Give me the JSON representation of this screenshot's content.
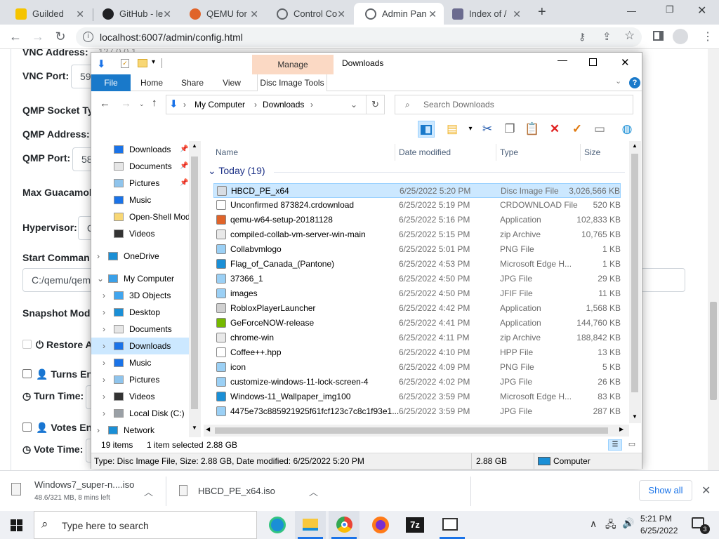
{
  "browser": {
    "tabs": [
      {
        "title": "Guilded",
        "active": false
      },
      {
        "title": "GitHub - le",
        "active": false
      },
      {
        "title": "QEMU for",
        "active": false
      },
      {
        "title": "Control Co",
        "active": false
      },
      {
        "title": "Admin Pan",
        "active": true
      },
      {
        "title": "Index of /",
        "active": false
      }
    ],
    "new_tab": "+",
    "url": "localhost:6007/admin/config.html"
  },
  "page": {
    "fields": {
      "vnc_address": "VNC Address:",
      "vnc_address_value": "127.0.0.1",
      "vnc_port": "VNC Port:",
      "vnc_port_value": "59",
      "qmp_socket": "QMP Socket Ty",
      "qmp_address": "QMP Address:",
      "qmp_port": "QMP Port:",
      "qmp_port_value": "58",
      "max_guac": "Max Guacamol",
      "hypervisor": "Hypervisor:",
      "hypervisor_value": "Q",
      "start_command": "Start Comman",
      "start_command_value": "C:/qemu/qem",
      "snapshot_mode": "Snapshot Mod",
      "restore": "Restore A",
      "turns_enabled": "Turns Ena",
      "turn_time": "Turn Time:",
      "votes_enabled": "Votes Ena",
      "vote_time": "Vote Time:"
    }
  },
  "downloads_bar": {
    "items": [
      {
        "name": "Windows7_super-n....iso",
        "status": "48.6/321 MB, 8 mins left"
      },
      {
        "name": "HBCD_PE_x64.iso",
        "status": ""
      }
    ],
    "show_all": "Show all"
  },
  "taskbar": {
    "search_placeholder": "Type here to search",
    "time": "5:21 PM",
    "date": "6/25/2022",
    "notification_count": "3"
  },
  "explorer": {
    "title": "Downloads",
    "manage_label": "Manage",
    "ribbon_tabs": [
      "File",
      "Home",
      "Share",
      "View",
      "Disc Image Tools"
    ],
    "breadcrumb": [
      "My Computer",
      "Downloads"
    ],
    "search_placeholder": "Search Downloads",
    "nav_items": [
      {
        "label": "Downloads",
        "pinned": true
      },
      {
        "label": "Documents",
        "pinned": true
      },
      {
        "label": "Pictures",
        "pinned": true
      },
      {
        "label": "Music",
        "pinned": false
      },
      {
        "label": "Open-Shell Mod",
        "pinned": false
      },
      {
        "label": "Videos",
        "pinned": false
      },
      {
        "label": "OneDrive",
        "pinned": false
      },
      {
        "label": "My Computer",
        "pinned": false
      },
      {
        "label": "3D Objects",
        "pinned": false
      },
      {
        "label": "Desktop",
        "pinned": false
      },
      {
        "label": "Documents",
        "pinned": false
      },
      {
        "label": "Downloads",
        "pinned": false
      },
      {
        "label": "Music",
        "pinned": false
      },
      {
        "label": "Pictures",
        "pinned": false
      },
      {
        "label": "Videos",
        "pinned": false
      },
      {
        "label": "Local Disk (C:)",
        "pinned": false
      },
      {
        "label": "Network",
        "pinned": false
      }
    ],
    "columns": [
      "Name",
      "Date modified",
      "Type",
      "Size"
    ],
    "group_label": "Today (19)",
    "files": [
      {
        "name": "HBCD_PE_x64",
        "date": "6/25/2022 5:20 PM",
        "type": "Disc Image File",
        "size": "3,026,566 KB",
        "icon": "disc-image-icon",
        "color": "#d8dde3"
      },
      {
        "name": "Unconfirmed 873824.crdownload",
        "date": "6/25/2022 5:19 PM",
        "type": "CRDOWNLOAD File",
        "size": "520 KB",
        "icon": "blank-file-icon",
        "color": "#ffffff"
      },
      {
        "name": "qemu-w64-setup-20181128",
        "date": "6/25/2022 5:16 PM",
        "type": "Application",
        "size": "102,833 KB",
        "icon": "qemu-icon",
        "color": "#e0642a"
      },
      {
        "name": "compiled-collab-vm-server-win-main",
        "date": "6/25/2022 5:15 PM",
        "type": "zip Archive",
        "size": "10,765 KB",
        "icon": "zip-icon",
        "color": "#e9e9e9"
      },
      {
        "name": "Collabvmlogo",
        "date": "6/25/2022 5:01 PM",
        "type": "PNG File",
        "size": "1 KB",
        "icon": "image-icon",
        "color": "#9bd0f5"
      },
      {
        "name": "Flag_of_Canada_(Pantone)",
        "date": "6/25/2022 4:53 PM",
        "type": "Microsoft Edge H...",
        "size": "1 KB",
        "icon": "edge-icon",
        "color": "#1a8fd6"
      },
      {
        "name": "37366_1",
        "date": "6/25/2022 4:50 PM",
        "type": "JPG File",
        "size": "29 KB",
        "icon": "image-icon",
        "color": "#9bd0f5"
      },
      {
        "name": "images",
        "date": "6/25/2022 4:50 PM",
        "type": "JFIF File",
        "size": "11 KB",
        "icon": "image-icon",
        "color": "#9bd0f5"
      },
      {
        "name": "RobloxPlayerLauncher",
        "date": "6/25/2022 4:42 PM",
        "type": "Application",
        "size": "1,568 KB",
        "icon": "app-icon",
        "color": "#d0d0d0"
      },
      {
        "name": "GeForceNOW-release",
        "date": "6/25/2022 4:41 PM",
        "type": "Application",
        "size": "144,760 KB",
        "icon": "geforce-icon",
        "color": "#76b900"
      },
      {
        "name": "chrome-win",
        "date": "6/25/2022 4:11 PM",
        "type": "zip Archive",
        "size": "188,842 KB",
        "icon": "zip-icon",
        "color": "#e9e9e9"
      },
      {
        "name": "Coffee++.hpp",
        "date": "6/25/2022 4:10 PM",
        "type": "HPP File",
        "size": "13 KB",
        "icon": "blank-file-icon",
        "color": "#ffffff"
      },
      {
        "name": "icon",
        "date": "6/25/2022 4:09 PM",
        "type": "PNG File",
        "size": "5 KB",
        "icon": "image-icon",
        "color": "#9bd0f5"
      },
      {
        "name": "customize-windows-11-lock-screen-4",
        "date": "6/25/2022 4:02 PM",
        "type": "JPG File",
        "size": "26 KB",
        "icon": "image-icon",
        "color": "#9bd0f5"
      },
      {
        "name": "Windows-11_Wallpaper_img100",
        "date": "6/25/2022 3:59 PM",
        "type": "Microsoft Edge H...",
        "size": "83 KB",
        "icon": "edge-icon",
        "color": "#1a8fd6"
      },
      {
        "name": "4475e73c885921925f61fcf123c7c8c1f93e1...",
        "date": "6/25/2022 3:59 PM",
        "type": "JPG File",
        "size": "287 KB",
        "icon": "image-icon",
        "color": "#9bd0f5"
      }
    ],
    "status": {
      "count": "19 items",
      "selected": "1 item selected",
      "selected_size": "2.88 GB"
    },
    "details": {
      "text": "Type: Disc Image File, Size: 2.88 GB, Date modified: 6/25/2022 5:20 PM",
      "size": "2.88 GB",
      "location": "Computer"
    }
  }
}
